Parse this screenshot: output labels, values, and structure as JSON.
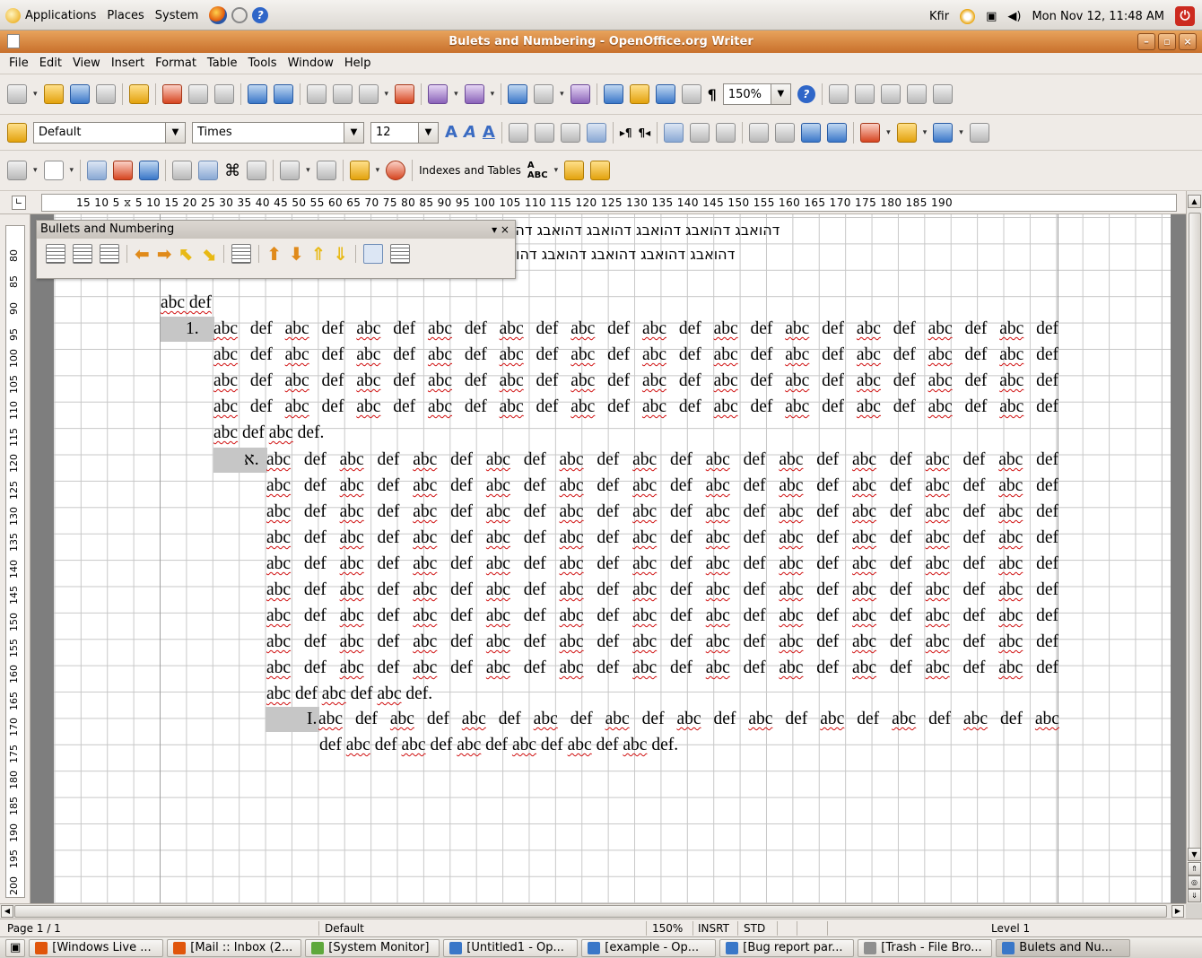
{
  "top_panel": {
    "menus": [
      "Applications",
      "Places",
      "System"
    ],
    "user": "Kfir",
    "datetime": "Mon Nov 12, 11:48 AM"
  },
  "window": {
    "title": "Bulets and Numbering - OpenOffice.org Writer"
  },
  "menubar": [
    "File",
    "Edit",
    "View",
    "Insert",
    "Format",
    "Table",
    "Tools",
    "Window",
    "Help"
  ],
  "standard_toolbar": {
    "zoom_value": "150%"
  },
  "formatting_toolbar": {
    "paragraph_style": "Default",
    "font_name": "Times",
    "font_size": "12"
  },
  "insert_toolbar": {
    "indexes_label": "Indexes and Tables"
  },
  "ruler": {
    "scale": "15  10  5  ⧖  5  10  15  20  25  30  35  40  45  50  55  60  65  70  75  80  85  90  95 100 105 110 115 120 125 130 135 140 145 150 155 160 165 170 175 180 185 190"
  },
  "vruler_numbers": [
    "80",
    "85",
    "90",
    "95",
    "100",
    "105",
    "110",
    "115",
    "120",
    "125",
    "130",
    "135",
    "140",
    "145",
    "150",
    "155",
    "160",
    "165",
    "170",
    "175",
    "180",
    "185",
    "190",
    "195",
    "200"
  ],
  "bullets_panel": {
    "title": "Bullets and Numbering",
    "close": "▾ ×"
  },
  "document": {
    "hebrew_line1": "דהואבג דהואבג דהואבג דהואבג דהואבג דהו",
    "hebrew_line2": "דהואבג דהואבג דהואבג דהואבג דהו.",
    "heading": "abc def",
    "list1_number": "1.",
    "list1_lines": [
      "abc def abc def abc def abc def abc def abc def abc def abc def abc def abc def abc def abc def",
      "abc def abc def abc def abc def abc def abc def abc def abc def abc def abc def abc def abc def",
      "abc def abc def abc def abc def abc def abc def abc def abc def abc def abc def abc def abc def",
      "abc def abc def abc def abc def abc def abc def abc def abc def abc def abc def abc def abc def",
      "abc def abc def."
    ],
    "list2_number": "א.",
    "list2_lines": [
      "abc def abc def abc def abc def abc def abc def abc def abc def abc def abc def abc def",
      "abc def abc def abc def abc def abc def abc def abc def abc def abc def abc def abc def",
      "abc def abc def abc def abc def abc def abc def abc def abc def abc def abc def abc def",
      "abc def abc def abc def abc def abc def abc def abc def abc def abc def abc def abc def",
      "abc def abc def abc def abc def abc def abc def abc def abc def abc def abc def abc def",
      "abc def abc def abc def abc def abc def abc def abc def abc def abc def abc def abc def",
      "abc def abc def abc def abc def abc def abc def abc def abc def abc def abc def abc def",
      "abc def abc def abc def abc def abc def abc def abc def abc def abc def abc def abc def",
      "abc def abc def abc def abc def abc def abc def abc def abc def abc def abc def abc def",
      "abc def abc def abc def."
    ],
    "list3_number": "I.",
    "list3_lines": [
      "abc def abc def abc def abc def abc def abc def abc def abc def abc def abc def abc",
      "def abc def abc def abc def abc def abc def abc def."
    ]
  },
  "statusbar": {
    "page": "Page 1 / 1",
    "style": "Default",
    "zoom": "150%",
    "mode": "INSRT",
    "sel": "STD",
    "level": "Level 1"
  },
  "taskbar": [
    {
      "label": "[Windows Live ...",
      "color": "#e0550b"
    },
    {
      "label": "[Mail :: Inbox (2...",
      "color": "#e0550b"
    },
    {
      "label": "[System Monitor]",
      "color": "#5ea83c"
    },
    {
      "label": "[Untitled1 - Op...",
      "color": "#3a77c8"
    },
    {
      "label": "[example - Op...",
      "color": "#3a77c8"
    },
    {
      "label": "[Bug report par...",
      "color": "#3a77c8"
    },
    {
      "label": "[Trash - File Bro...",
      "color": "#8f8f8f"
    },
    {
      "label": "Bulets and Nu...",
      "color": "#3a77c8"
    }
  ]
}
